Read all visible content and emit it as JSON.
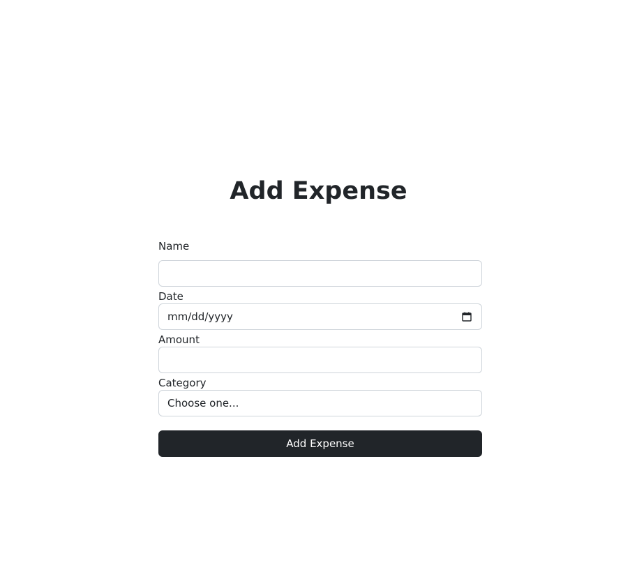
{
  "page": {
    "title": "Add Expense"
  },
  "form": {
    "name": {
      "label": "Name",
      "value": ""
    },
    "date": {
      "label": "Date",
      "placeholder": "mm/dd/yyyy",
      "icon": "calendar-icon"
    },
    "amount": {
      "label": "Amount",
      "value": ""
    },
    "category": {
      "label": "Category",
      "selected": "Choose one..."
    },
    "submit_label": "Add Expense"
  },
  "colors": {
    "text": "#212529",
    "border": "#ced4da",
    "button_bg": "#212529",
    "button_text": "#ffffff",
    "background": "#ffffff"
  }
}
